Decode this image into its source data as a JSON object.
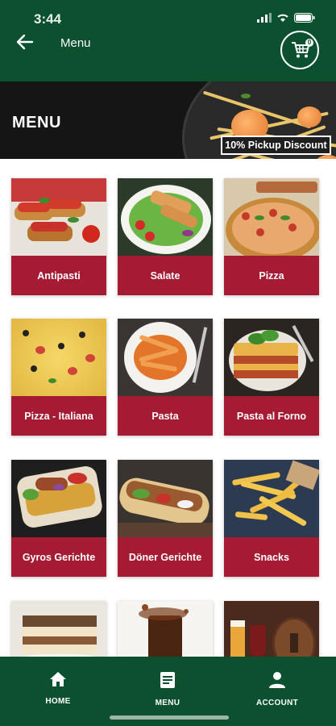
{
  "status": {
    "time": "3:44"
  },
  "header": {
    "title": "Menu",
    "cart_count": "0"
  },
  "banner": {
    "title": "MENU",
    "discount": "10% Pickup Discount"
  },
  "categories": [
    {
      "label": "Antipasti",
      "image": "bruschetta"
    },
    {
      "label": "Salate",
      "image": "salad"
    },
    {
      "label": "Pizza",
      "image": "pizza"
    },
    {
      "label": "Pizza - Italiana",
      "image": "pizza-italiana"
    },
    {
      "label": "Pasta",
      "image": "pasta"
    },
    {
      "label": "Pasta al Forno",
      "image": "lasagna"
    },
    {
      "label": "Gyros Gerichte",
      "image": "gyros"
    },
    {
      "label": "Döner Gerichte",
      "image": "doner"
    },
    {
      "label": "Snacks",
      "image": "fries"
    },
    {
      "label": "",
      "image": "tiramisu"
    },
    {
      "label": "",
      "image": "drinks"
    },
    {
      "label": "",
      "image": "beer"
    }
  ],
  "nav": [
    {
      "label": "HOME",
      "icon": "home-icon"
    },
    {
      "label": "MENU",
      "icon": "menu-icon"
    },
    {
      "label": "ACCOUNT",
      "icon": "account-icon"
    }
  ],
  "colors": {
    "header": "#0b5130",
    "label": "#a51b33"
  }
}
